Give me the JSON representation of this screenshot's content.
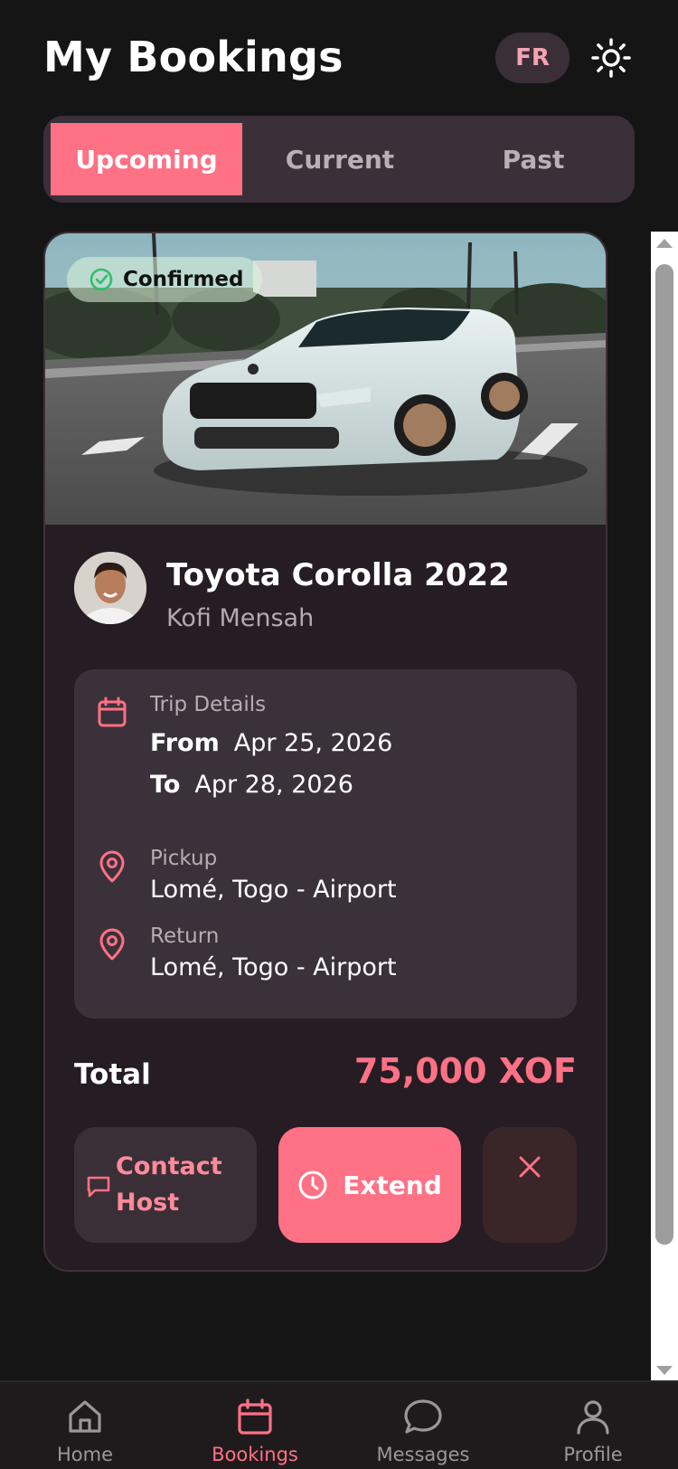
{
  "header": {
    "title": "My Bookings",
    "language": "FR"
  },
  "tabs": [
    {
      "label": "Upcoming",
      "active": true
    },
    {
      "label": "Current",
      "active": false
    },
    {
      "label": "Past",
      "active": false
    }
  ],
  "booking": {
    "status": "Confirmed",
    "car_name": "Toyota Corolla 2022",
    "host_name": "Kofi Mensah",
    "trip": {
      "label": "Trip Details",
      "from_label": "From",
      "from_date": "Apr 25, 2026",
      "to_label": "To",
      "to_date": "Apr 28, 2026"
    },
    "pickup": {
      "label": "Pickup",
      "location": "Lomé, Togo - Airport"
    },
    "return": {
      "label": "Return",
      "location": "Lomé, Togo - Airport"
    },
    "total_label": "Total",
    "total_value": "75,000 XOF",
    "actions": {
      "contact": "Contact Host",
      "extend": "Extend"
    }
  },
  "nav": [
    {
      "label": "Home",
      "icon": "home-icon",
      "active": false
    },
    {
      "label": "Bookings",
      "icon": "calendar-icon",
      "active": true
    },
    {
      "label": "Messages",
      "icon": "chat-icon",
      "active": false
    },
    {
      "label": "Profile",
      "icon": "user-icon",
      "active": false
    }
  ],
  "colors": {
    "accent": "#ff7185",
    "background": "#161516",
    "card": "#261c24",
    "panel": "#3b313a",
    "success": "#2fbf6a"
  }
}
